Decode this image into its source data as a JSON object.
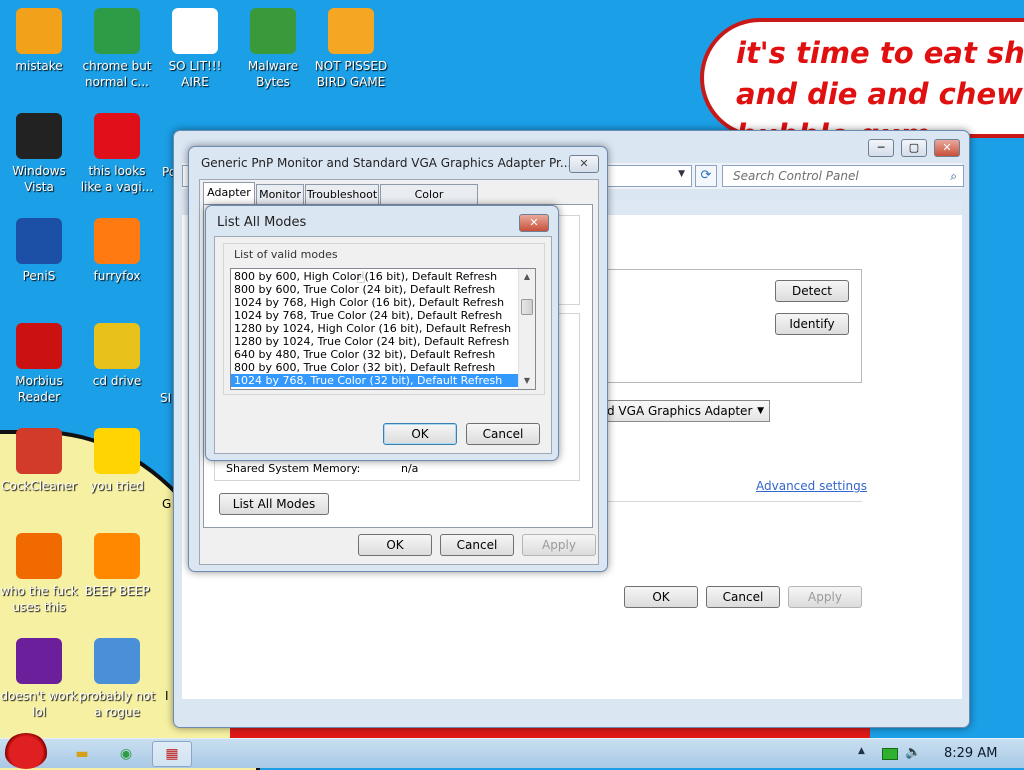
{
  "desktop": {
    "bubble_lines": [
      "it's time to eat shit",
      "and die and chew",
      "bubble gum"
    ],
    "icons": [
      {
        "label": "mistake",
        "icon": "folder-computer-icon",
        "color": "#f2a11b"
      },
      {
        "label": "chrome but normal c...",
        "icon": "chrome-icon",
        "color": "#2e9b46"
      },
      {
        "label": "SO LIT!!! AIRE",
        "icon": "solitaire-icon",
        "color": "#ffffff"
      },
      {
        "label": "Malware Bytes",
        "icon": "shield-check-icon",
        "color": "#3a9a3a"
      },
      {
        "label": "NOT PISSED BIRD GAME",
        "icon": "green-pig-icon",
        "color": "#f5a623"
      },
      {
        "label": "Windows Vista",
        "icon": "trash-bin-icon",
        "color": "#222222"
      },
      {
        "label": "this looks like a vagi...",
        "icon": "opera-icon",
        "color": "#e0101a"
      },
      {
        "label": "PeniS",
        "icon": "photoshop-icon",
        "color": "#1c4fa6"
      },
      {
        "label": "furryfox",
        "icon": "firefox-icon",
        "color": "#ff7a10"
      },
      {
        "label": "Morbius Reader",
        "icon": "acrobat-icon",
        "color": "#cc1111"
      },
      {
        "label": "cd drive",
        "icon": "cd-icon",
        "color": "#e8c21a"
      },
      {
        "label": "CockCleaner",
        "icon": "ccleaner-icon",
        "color": "#d23a2a"
      },
      {
        "label": "you tried",
        "icon": "star-icon",
        "color": "#ffd400"
      },
      {
        "label": "who the fuck uses this",
        "icon": "avast-icon",
        "color": "#f06a00"
      },
      {
        "label": "BEEP BEEP",
        "icon": "vlc-cone-icon",
        "color": "#ff8800"
      },
      {
        "label": "doesn't work lol",
        "icon": "yahoo-icon",
        "color": "#6b1f9a"
      },
      {
        "label": "probably not a rogue",
        "icon": "gears-icon",
        "color": "#4a90d9"
      }
    ],
    "partial_labels": [
      "Po",
      "SI",
      "G",
      "I"
    ]
  },
  "control_panel": {
    "search_placeholder": "Search Control Panel",
    "detect_label": "Detect",
    "identify_label": "Identify",
    "adapter_select": "d VGA Graphics Adapter",
    "advanced_link": "Advanced settings",
    "ok_label": "OK",
    "cancel_label": "Cancel",
    "apply_label": "Apply"
  },
  "properties": {
    "title": "Generic PnP Monitor and Standard VGA Graphics Adapter Pr...",
    "tabs": [
      "Adapter",
      "Monitor",
      "Troubleshoot",
      "Color Management"
    ],
    "shared_memory_label": "Shared System Memory:",
    "shared_memory_value": "n/a",
    "list_all_modes_label": "List All Modes",
    "ok_label": "OK",
    "cancel_label": "Cancel",
    "apply_label": "Apply"
  },
  "list_modes": {
    "title": "List All Modes",
    "group_label": "List of valid modes",
    "modes": [
      "800 by 600, High Color (16 bit), Default Refresh",
      "800 by 600, True Color (24 bit), Default Refresh",
      "1024 by 768, High Color (16 bit), Default Refresh",
      "1024 by 768, True Color (24 bit), Default Refresh",
      "1280 by 1024, High Color (16 bit), Default Refresh",
      "1280 by 1024, True Color (24 bit), Default Refresh",
      "640 by 480, True Color (32 bit), Default Refresh",
      "800 by 600, True Color (32 bit), Default Refresh",
      "1024 by 768, True Color (32 bit), Default Refresh"
    ],
    "selected_index": 8,
    "ok_label": "OK",
    "cancel_label": "Cancel"
  },
  "taskbar": {
    "clock": "8:29 AM",
    "tray_arrow": "▲"
  }
}
